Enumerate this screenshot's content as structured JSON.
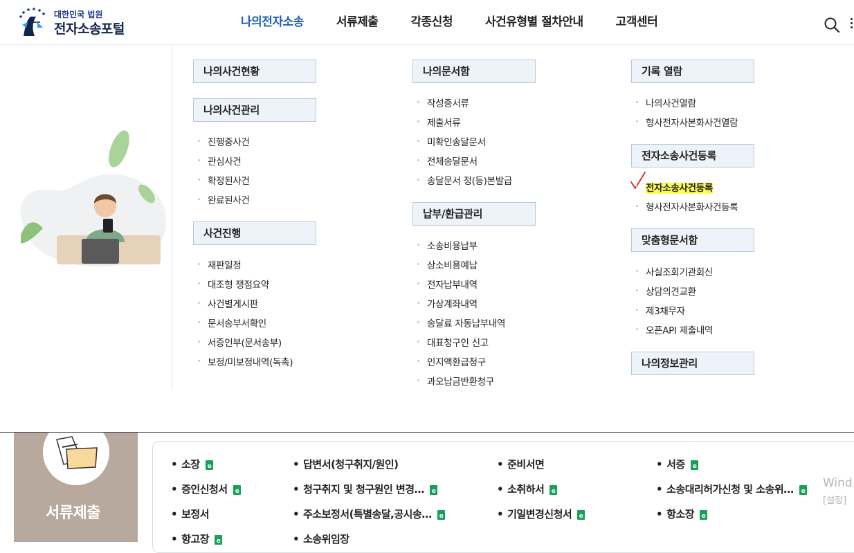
{
  "header": {
    "logo_small": "대한민국 법원",
    "logo_big": "전자소송포털",
    "nav": [
      "나의전자소송",
      "서류제출",
      "각종신청",
      "사건유형별 절차안내",
      "고객센터"
    ],
    "active_nav": "나의전자소송",
    "icons": [
      "search-icon",
      "more-icon"
    ]
  },
  "menu": {
    "col1": {
      "cat1": "나의사건현황",
      "cat2": "나의사건관리",
      "cat2_items": [
        "진행중사건",
        "관심사건",
        "확정된사건",
        "완료된사건"
      ],
      "cat3": "사건진행",
      "cat3_items": [
        "재판일정",
        "대조형 쟁점요약",
        "사건별게시판",
        "문서송부서확인",
        "서증인부(문서송부)",
        "보정/미보정내역(독촉)"
      ]
    },
    "col2": {
      "cat1": "나의문서함",
      "cat1_items": [
        "작성중서류",
        "제출서류",
        "미확인송달문서",
        "전체송달문서",
        "송달문서 정(등)본발급"
      ],
      "cat2": "납부/환급관리",
      "cat2_items": [
        "소송비용납부",
        "상소비용예납",
        "전자납부내역",
        "가상계좌내역",
        "송달료 자동납부내역",
        "대표청구인 신고",
        "인지액환급청구",
        "과오납금반환청구"
      ]
    },
    "col3": {
      "cat1": "기록 열람",
      "cat1_items": [
        "나의사건열람",
        "형사전자사본화사건열람"
      ],
      "cat2": "전자소송사건등록",
      "cat2_items": [
        "전자소송사건등록",
        "형사전자사본화사건등록"
      ],
      "cat3": "맞춤형문서함",
      "cat3_items": [
        "사실조회기관회신",
        "상담의견교환",
        "제3채무자",
        "오픈API 제출내역"
      ],
      "cat4": "나의정보관리"
    },
    "highlight_color": "#fdfd54"
  },
  "docs": {
    "banner_title": "서류제출",
    "items": [
      "소장",
      "답변서(청구취지/원인)",
      "준비서면",
      "서증",
      "증인신청서",
      "청구취지 및 청구원인 변경…",
      "소취하서",
      "소송대리허가신청 및 소송위…",
      "보정서",
      "주소보정서(특별송달,공시송…",
      "기일변경신청서",
      "항소장",
      "항고장",
      "소송위임장"
    ]
  },
  "watermark": {
    "line1": "Wind",
    "line2": "[설정]"
  },
  "colors": {
    "accent": "#1f5bbf",
    "cat_bg": "#eef3f9",
    "cat_border": "#b7c7db",
    "doc_icon": "#18a05a"
  }
}
